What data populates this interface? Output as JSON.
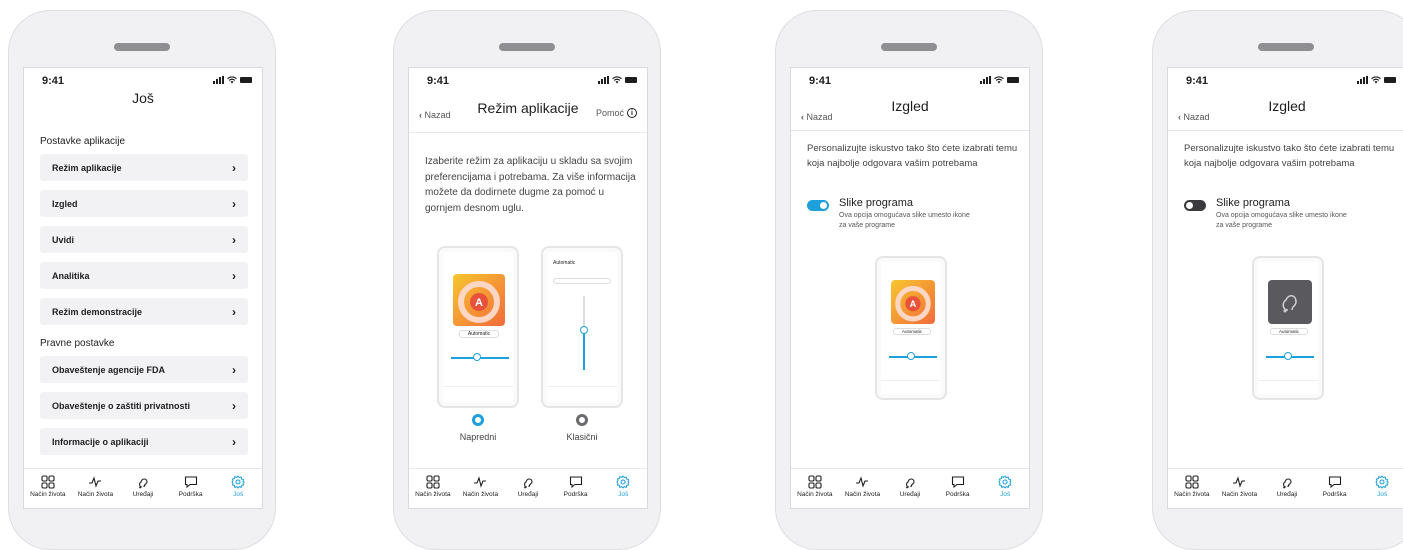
{
  "status": {
    "time": "9:41"
  },
  "screens": {
    "more": {
      "title": "Još",
      "section_app": "Postavke aplikacije",
      "app_items": [
        "Režim aplikacije",
        "Izgled",
        "Uvidi",
        "Analitika",
        "Režim demonstracije"
      ],
      "section_legal": "Pravne postavke",
      "legal_items": [
        "Obaveštenje agencije FDA",
        "Obaveštenje o zaštiti privatnosti",
        "Informacije o aplikaciji"
      ]
    },
    "app_mode": {
      "back": "Nazad",
      "title": "Režim aplikacije",
      "help": "Pomoć",
      "description": "Izaberite režim za aplikaciju u skladu sa svojim preferencijama i potrebama. Za više informacija možete da dodirnete dugme za pomoć u gornjem desnom uglu.",
      "options": [
        {
          "label": "Napredni",
          "selected": true
        },
        {
          "label": "Klasični",
          "selected": false
        }
      ],
      "mini_label": "Automatic"
    },
    "appearance_on": {
      "back": "Nazad",
      "title": "Izgled",
      "description": "Personalizujte iskustvo tako što ćete izabrati temu koja najbolje odgovara vašim potrebama",
      "toggle_title": "Slike programa",
      "toggle_desc": "Ova opcija omogućava slike umesto ikone za vaše programe",
      "toggle_on": true,
      "mini_label": "Automatic"
    },
    "appearance_off": {
      "back": "Nazad",
      "title": "Izgled",
      "description": "Personalizujte iskustvo tako što ćete izabrati temu koja najbolje odgovara vašim potrebama",
      "toggle_title": "Slike programa",
      "toggle_desc": "Ova opcija omogućava slike umesto ikone za vaše programe",
      "toggle_on": false,
      "mini_label": "Automatic"
    }
  },
  "tabs": [
    {
      "label": "Način života",
      "icon": "grid-icon"
    },
    {
      "label": "Način života",
      "icon": "activity-icon"
    },
    {
      "label": "Uređaji",
      "icon": "hearing-aid-icon"
    },
    {
      "label": "Podrška",
      "icon": "chat-icon"
    },
    {
      "label": "Još",
      "icon": "gear-icon",
      "active": true
    }
  ],
  "colors": {
    "accent": "#1ea0dc",
    "card_bg": "#f2f2f4",
    "toggle_off": "#3a3a3c"
  }
}
